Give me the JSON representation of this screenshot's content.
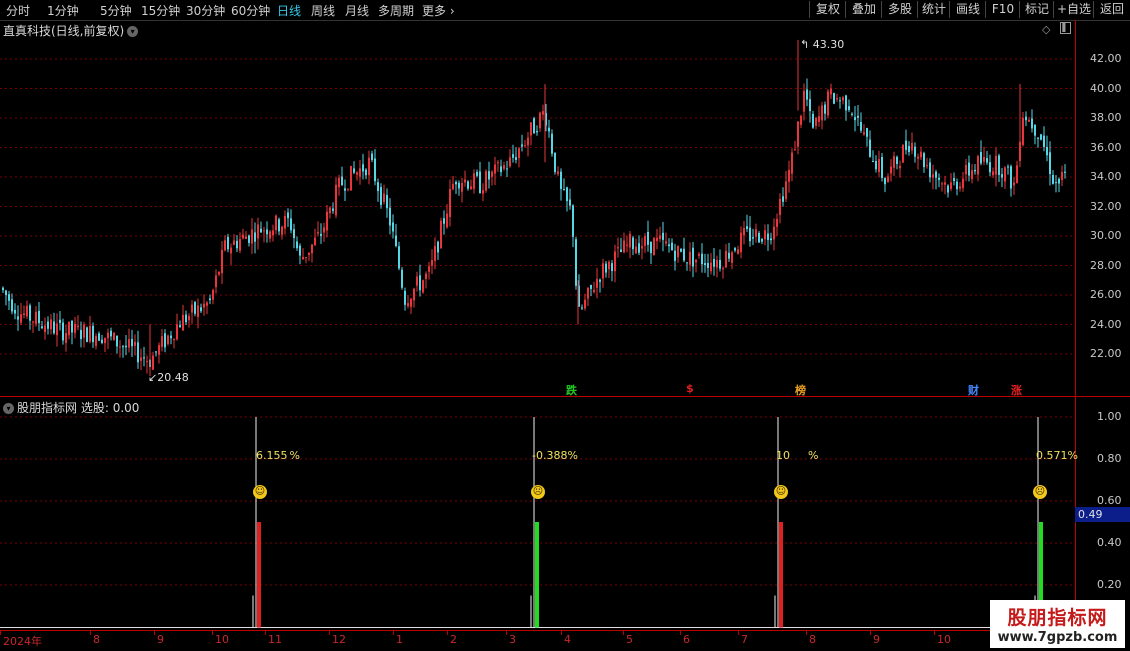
{
  "period_tabs": [
    "分时",
    "1分钟",
    "5分钟",
    "15分钟",
    "30分钟",
    "60分钟",
    "日线",
    "周线",
    "月线",
    "多周期",
    "更多"
  ],
  "active_period": "日线",
  "right_buttons": [
    "复权",
    "叠加",
    "多股",
    "统计",
    "画线",
    "F10",
    "标记",
    "+自选",
    "返回"
  ],
  "chart_title": "直真科技(日线,前复权)",
  "price_axis": [
    "42.00",
    "40.00",
    "38.00",
    "36.00",
    "34.00",
    "32.00",
    "30.00",
    "28.00",
    "26.00",
    "24.00",
    "22.00"
  ],
  "high_label": "43.30",
  "low_label": "20.48",
  "event_tags": [
    {
      "text": "跌",
      "color": "#22cc22"
    },
    {
      "text": "$",
      "color": "#e02020"
    },
    {
      "text": "榜",
      "color": "#e8a020"
    },
    {
      "text": "财",
      "color": "#4488ff"
    },
    {
      "text": "涨",
      "color": "#e02020"
    }
  ],
  "indicator_title": "股朋指标网",
  "indicator_select": "选股: 0.00",
  "indicator_axis": [
    "1.00",
    "0.80",
    "0.60",
    "0.40",
    "0.20"
  ],
  "current_value": "0.49",
  "signals": [
    {
      "pct": "6.155",
      "pct_suffix": "%",
      "face": "☺",
      "bar_color": "#e02020"
    },
    {
      "pct": "-0.388",
      "pct_suffix": "%",
      "face": "☹",
      "bar_color": "#20dd20"
    },
    {
      "pct": "10",
      "pct_suffix": "%",
      "face": "☺",
      "bar_color": "#e02020"
    },
    {
      "pct": "0.571",
      "pct_suffix": "%",
      "face": "☹",
      "bar_color": "#20dd20"
    }
  ],
  "dates": [
    "2024年",
    "8",
    "9",
    "10",
    "11",
    "12",
    "1",
    "2",
    "3",
    "4",
    "5",
    "6",
    "7",
    "8",
    "9",
    "10"
  ],
  "watermark": {
    "title": "股朋指标网",
    "url": "www.7gpzb.com"
  },
  "colors": {
    "up": "#e8363c",
    "down": "#54d8e8",
    "grid": "#7a0000",
    "axis": "#b00000"
  }
}
